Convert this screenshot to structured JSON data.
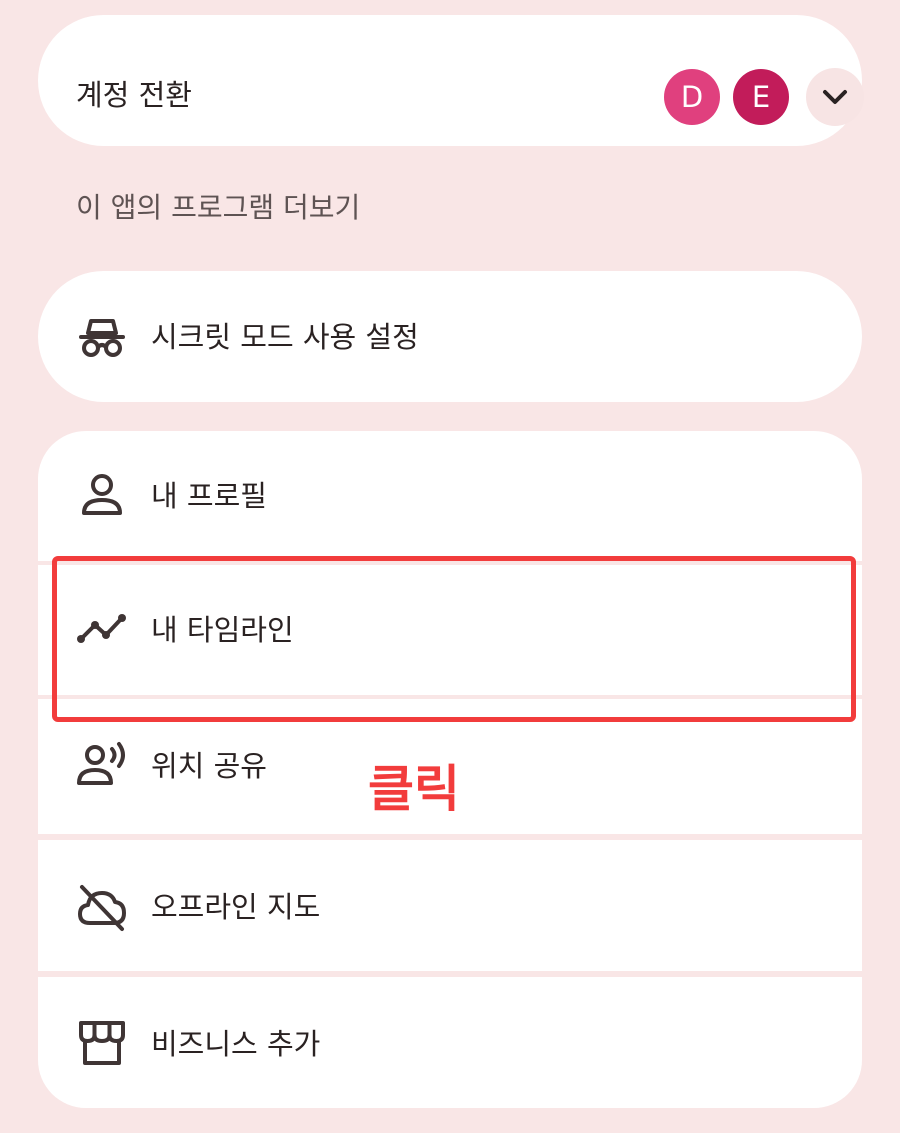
{
  "account_switcher": {
    "title": "계정 전환",
    "avatars": [
      {
        "initial": "D",
        "color": "#e0407e"
      },
      {
        "initial": "E",
        "color": "#c21c5a"
      }
    ],
    "expand_icon": "chevron-down-icon"
  },
  "section_label": "이 앱의 프로그램 더보기",
  "incognito": {
    "label": "시크릿 모드 사용 설정",
    "icon": "incognito-icon"
  },
  "menu": {
    "items": [
      {
        "label": "내 프로필",
        "icon": "person-icon"
      },
      {
        "label": "내 타임라인",
        "icon": "timeline-icon"
      },
      {
        "label": "위치 공유",
        "icon": "location-sharing-icon"
      },
      {
        "label": "오프라인 지도",
        "icon": "offline-map-icon"
      },
      {
        "label": "비즈니스 추가",
        "icon": "storefront-icon"
      }
    ]
  },
  "annotation": {
    "label": "클릭",
    "color": "#f23c3c"
  },
  "colors": {
    "background": "#f9e6e6",
    "card": "#ffffff",
    "text": "#2a2222",
    "muted_text": "#5e5353",
    "icon": "#3f3535"
  }
}
